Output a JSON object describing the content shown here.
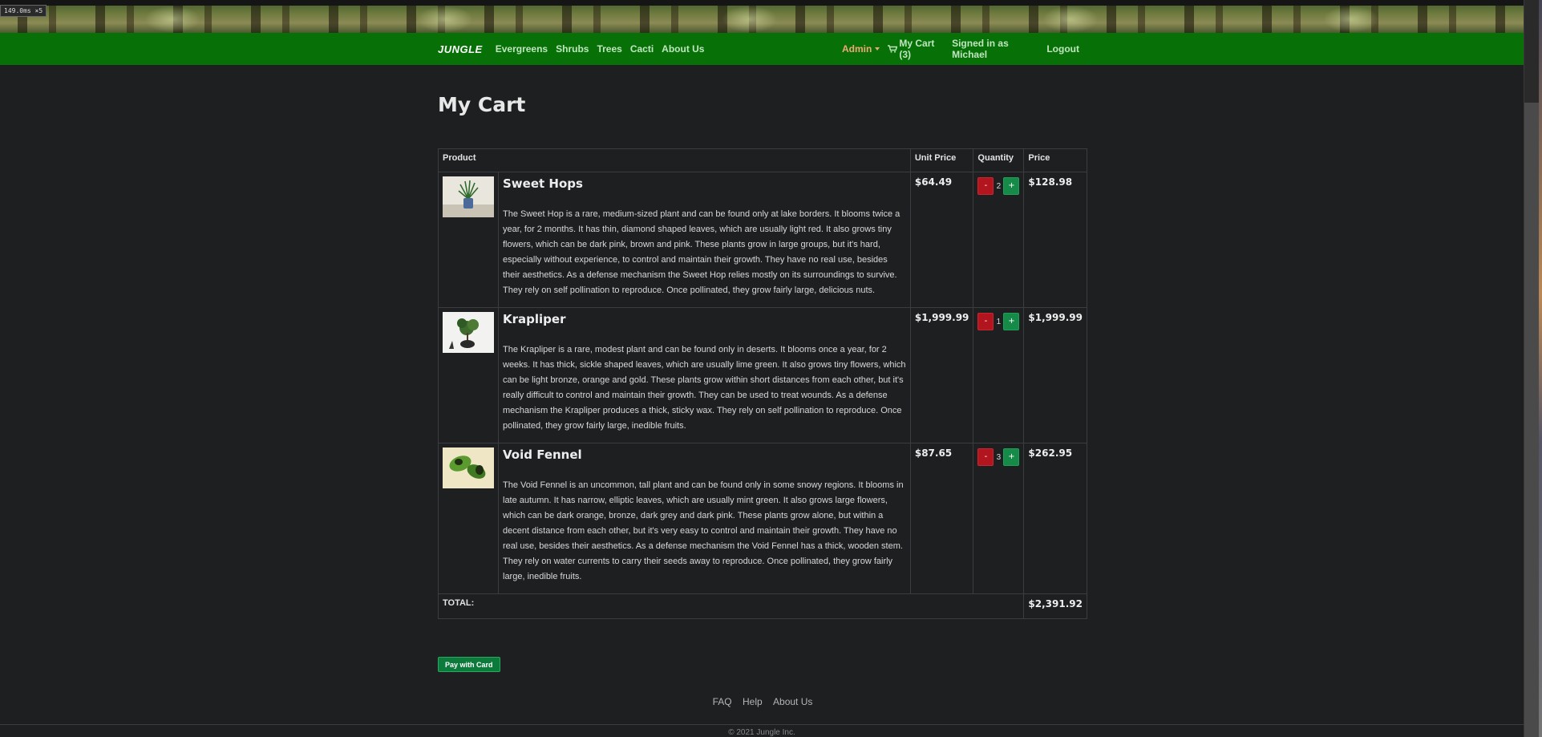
{
  "overlay": {
    "timing": "149.0ms ×5"
  },
  "navbar": {
    "brand": "JUNGLE",
    "links": [
      "Evergreens",
      "Shrubs",
      "Trees",
      "Cacti",
      "About Us"
    ],
    "admin": "Admin",
    "cart": "My Cart (3)",
    "signed_in": "Signed in as Michael",
    "logout": "Logout"
  },
  "page": {
    "title": "My Cart"
  },
  "table": {
    "headers": [
      "Product",
      "Unit Price",
      "Quantity",
      "Price"
    ],
    "rows": [
      {
        "name": "Sweet Hops",
        "description": "The Sweet Hop is a rare, medium-sized plant and can be found only at lake borders. It blooms twice a year, for 2 months. It has thin, diamond shaped leaves, which are usually light red. It also grows tiny flowers, which can be dark pink, brown and pink. These plants grow in large groups, but it's hard, especially without experience, to control and maintain their growth. They have no real use, besides their aesthetics. As a defense mechanism the Sweet Hop relies mostly on its surroundings to survive. They rely on self pollination to reproduce. Once pollinated, they grow fairly large, delicious nuts.",
        "unit_price": "$64.49",
        "quantity": "2",
        "price": "$128.98",
        "minus": "-",
        "plus": "+"
      },
      {
        "name": "Krapliper",
        "description": "The Krapliper is a rare, modest plant and can be found only in deserts. It blooms once a year, for 2 weeks. It has thick, sickle shaped leaves, which are usually lime green. It also grows tiny flowers, which can be light bronze, orange and gold. These plants grow within short distances from each other, but it's really difficult to control and maintain their growth. They can be used to treat wounds. As a defense mechanism the Krapliper produces a thick, sticky wax. They rely on self pollination to reproduce. Once pollinated, they grow fairly large, inedible fruits.",
        "unit_price": "$1,999.99",
        "quantity": "1",
        "price": "$1,999.99",
        "minus": "-",
        "plus": "+"
      },
      {
        "name": "Void Fennel",
        "description": "The Void Fennel is an uncommon, tall plant and can be found only in some snowy regions. It blooms in late autumn. It has narrow, elliptic leaves, which are usually mint green. It also grows large flowers, which can be dark orange, bronze, dark grey and dark pink. These plants grow alone, but within a decent distance from each other, but it's very easy to control and maintain their growth. They have no real use, besides their aesthetics. As a defense mechanism the Void Fennel has a thick, wooden stem. They rely on water currents to carry their seeds away to reproduce. Once pollinated, they grow fairly large, inedible fruits.",
        "unit_price": "$87.65",
        "quantity": "3",
        "price": "$262.95",
        "minus": "-",
        "plus": "+"
      }
    ],
    "total_label": "TOTAL:",
    "total_value": "$2,391.92"
  },
  "pay_button": "Pay with Card",
  "footer": {
    "links": [
      "FAQ",
      "Help",
      "About Us"
    ],
    "copyright": "© 2021 Jungle Inc."
  },
  "colors": {
    "navbar": "#077007",
    "background": "#1e1f21",
    "minus_button": "#b3151f",
    "plus_button": "#168a48",
    "admin": "#f0a875"
  }
}
